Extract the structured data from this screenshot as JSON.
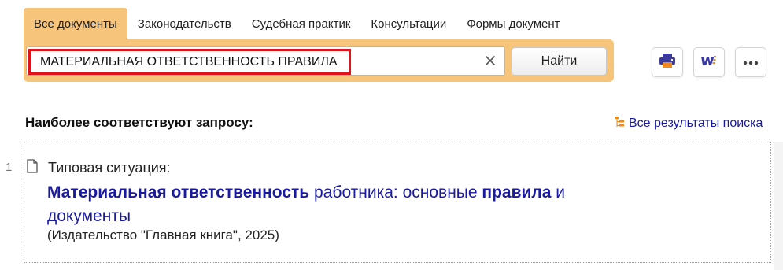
{
  "tabs": [
    {
      "label": "Все документы",
      "active": true
    },
    {
      "label": "Законодательств",
      "active": false
    },
    {
      "label": "Судебная практик",
      "active": false
    },
    {
      "label": "Консультации",
      "active": false
    },
    {
      "label": "Формы документ",
      "active": false
    }
  ],
  "search": {
    "value": "МАТЕРИАЛЬНАЯ ОТВЕТСТВЕННОСТЬ ПРАВИЛА",
    "clear_icon": "close-icon",
    "button_label": "Найти"
  },
  "toolbar": {
    "print_icon": "printer-icon",
    "word_icon": "word-export-icon",
    "more_icon": "more-icon"
  },
  "results_section": {
    "heading": "Наиболее соответствуют запросу:",
    "all_results_label": "Все результаты поиска"
  },
  "results": [
    {
      "number": "1",
      "type": "Типовая ситуация:",
      "title_parts": [
        {
          "text": "Материальная ответственность",
          "bold": true
        },
        {
          "text": " работника: основные ",
          "bold": false
        },
        {
          "text": "правила",
          "bold": true
        },
        {
          "text": " и документы",
          "bold": false
        }
      ],
      "source": "(Издательство \"Главная книга\", 2025)"
    }
  ],
  "colors": {
    "accent": "#f7c47c",
    "link": "#1a1aa0",
    "highlight_border": "#e0141b",
    "icon_purple": "#3b3b9e",
    "icon_orange": "#f08a1c"
  }
}
